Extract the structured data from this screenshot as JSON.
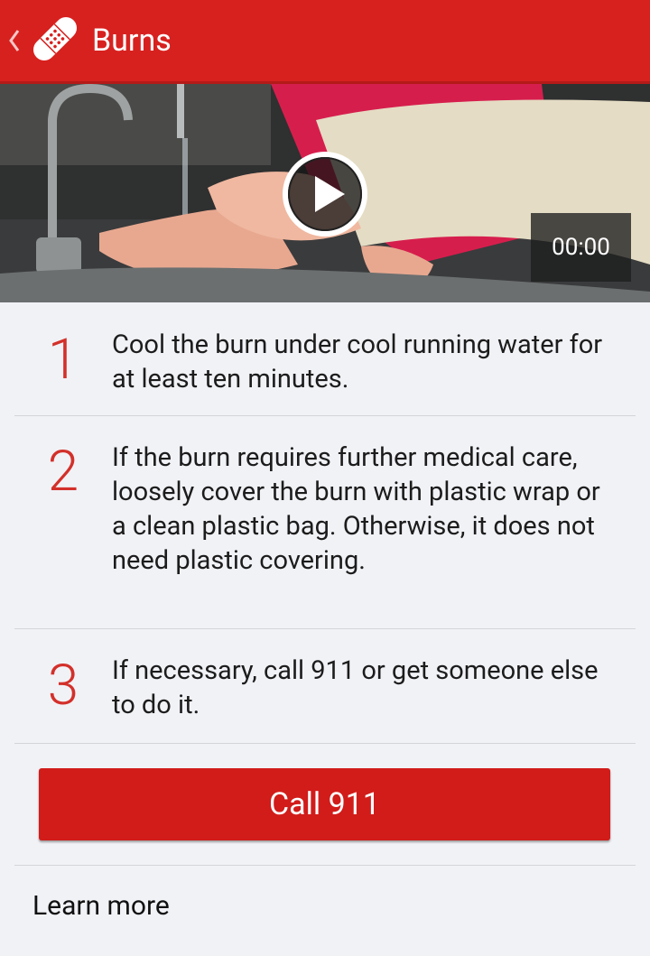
{
  "header": {
    "title": "Burns"
  },
  "video": {
    "time": "00:00"
  },
  "steps": [
    {
      "num": "1",
      "text": "Cool the burn under cool running water for at least ten minutes."
    },
    {
      "num": "2",
      "text": "If the burn requires further medical care, loosely cover the burn with plastic wrap or a clean plastic bag. Otherwise, it does not need plastic covering."
    },
    {
      "num": "3",
      "text": "If necessary, call 911 or get someone else to do it."
    }
  ],
  "cta": {
    "label": "Call 911"
  },
  "learn_more": "Learn more",
  "colors": {
    "brand_red": "#d7211f",
    "number_red": "#d3302a"
  }
}
